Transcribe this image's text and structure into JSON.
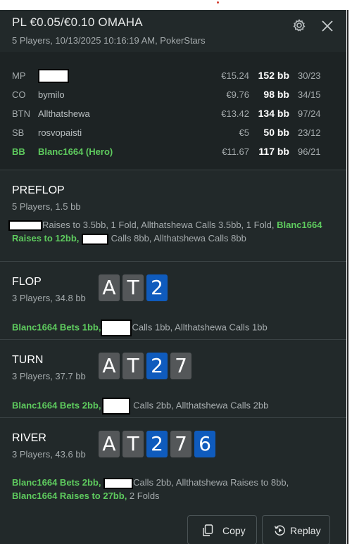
{
  "header": {
    "title": "PL €0.05/€0.10 OMAHA",
    "subtitle": "5 Players, 10/13/2025 10:16:19 AM, PokerStars"
  },
  "players": [
    {
      "pos": "MP",
      "name": "",
      "money": "€15.24",
      "bb": "152 bb",
      "stats": "30/23"
    },
    {
      "pos": "CO",
      "name": "bymilo",
      "money": "€9.76",
      "bb": "98 bb",
      "stats": "34/15"
    },
    {
      "pos": "BTN",
      "name": "Allthatshewa",
      "money": "€13.42",
      "bb": "134 bb",
      "stats": "97/24"
    },
    {
      "pos": "SB",
      "name": "rosvopaisti",
      "money": "€5",
      "bb": "50 bb",
      "stats": "23/12"
    },
    {
      "pos": "BB",
      "name": "Blanc1664 (Hero)",
      "money": "€11.67",
      "bb": "117 bb",
      "stats": "96/21"
    }
  ],
  "preflop": {
    "title": "PREFLOP",
    "sub": "5 Players, 1.5 bb",
    "a1": "Raises to 3.5bb, 1 Fold, Allthatshewa Calls 3.5bb, 1 Fold, ",
    "a2": "Blanc1664",
    "a3": "Raises to 12bb,",
    "a4": " Calls 8bb, Allthatshewa Calls 8bb"
  },
  "flop": {
    "title": "FLOP",
    "sub": "3 Players, 34.8 bb",
    "cards": [
      "A",
      "T",
      "2"
    ],
    "hero": "Blanc1664 Bets 1bb,",
    "rest": "Calls 1bb, Allthatshewa Calls 1bb"
  },
  "turn": {
    "title": "TURN",
    "sub": "3 Players, 37.7 bb",
    "cards": [
      "A",
      "T",
      "2",
      "7"
    ],
    "hero": "Blanc1664 Bets 2bb,",
    "rest": "Calls 2bb, Allthatshewa Calls 2bb"
  },
  "river": {
    "title": "RIVER",
    "sub": "3 Players, 43.6 bb",
    "cards": [
      "A",
      "T",
      "2",
      "7",
      "6"
    ],
    "hero": "Blanc1664 Bets 2bb,",
    "rest": "Calls 2bb, Allthatshewa Raises to 8bb,",
    "hero2": "Blanc1664 Raises to 27bb,",
    "rest2": " 2 Folds"
  },
  "footer": {
    "copy_label": "Copy",
    "replay_label": "Replay"
  },
  "colors": {
    "background": "#22292a",
    "players_bg": "#1d2324",
    "hero_green": "#5ecb5e",
    "card_grey": "#545759",
    "card_blue": "#0f5bbd"
  },
  "icons": {
    "settings": "gear-icon",
    "close": "close-icon",
    "copy": "copy-icon",
    "replay": "replay-icon"
  }
}
